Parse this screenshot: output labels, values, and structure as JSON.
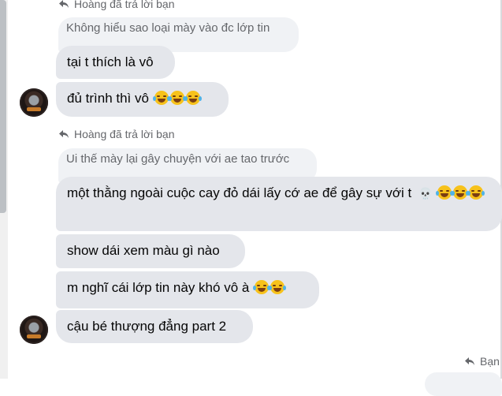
{
  "conversation": {
    "reply_label_1": "Hoàng đã trả lời bạn",
    "quoted_1": "Không hiểu sao loại mày vào đc lớp tin",
    "msg_1": "tại t thích là vô",
    "msg_2": "đủ trình thì vô",
    "reply_label_2": "Hoàng đã trả lời bạn",
    "quoted_2": "Ui thế mày lại gây chuyện với ae tao trước",
    "msg_3": "một thằng ngoài cuộc cay đỏ dái lấy cớ ae để gây sự với t",
    "msg_4": "show dái xem màu gì nào",
    "msg_5": "m nghĩ cái lớp tin này khó vô à",
    "msg_6": "cậu bé thượng đẳng part 2",
    "reply_label_3": "Bạn"
  },
  "icons": {
    "reply": "reply-arrow-icon",
    "emoji": "face-with-tears-of-joy-icon",
    "skull": "skull-icon"
  },
  "colors": {
    "bubble": "#e4e6eb",
    "quoted": "#f0f2f5",
    "muted_text": "#65676b"
  }
}
